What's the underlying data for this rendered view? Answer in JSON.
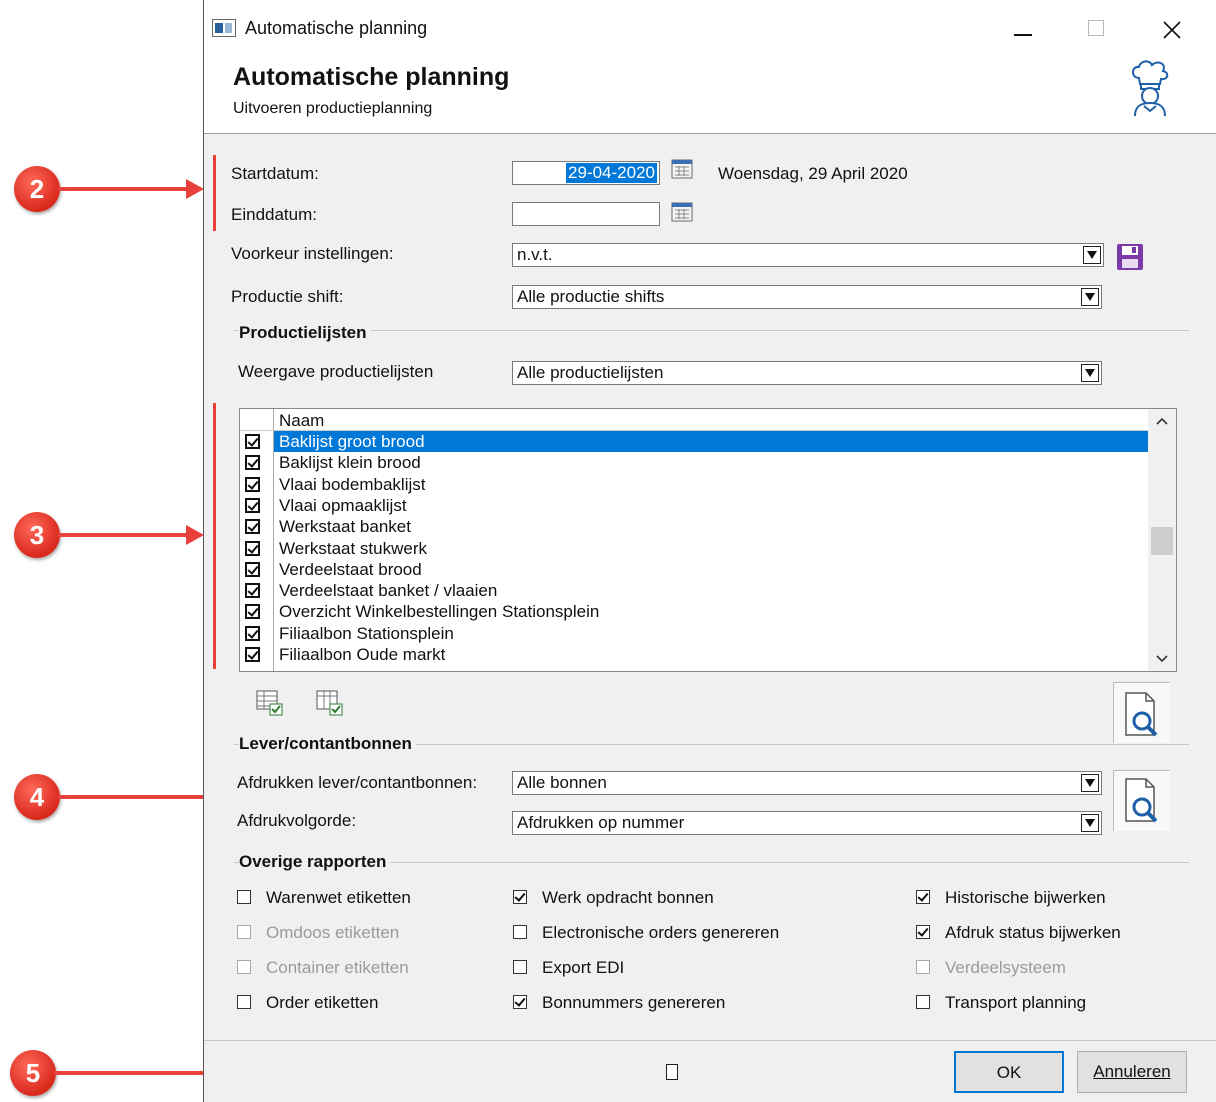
{
  "window": {
    "title": "Automatische planning",
    "heading": "Automatische planning",
    "subheading": "Uitvoeren productieplanning"
  },
  "form": {
    "startdatum_label": "Startdatum:",
    "startdatum_value": "29-04-2020",
    "startdatum_text": "Woensdag, 29 April 2020",
    "einddatum_label": "Einddatum:",
    "einddatum_value": "",
    "voorkeur_label": "Voorkeur instellingen:",
    "voorkeur_value": "n.v.t.",
    "shift_label": "Productie shift:",
    "shift_value": "Alle productie shifts"
  },
  "productielijsten": {
    "group_label": "Productielijsten",
    "weergave_label": "Weergave productielijsten",
    "weergave_value": "Alle productielijsten",
    "column_header": "Naam",
    "items": [
      {
        "name": "Baklijst groot brood",
        "checked": true,
        "selected": true
      },
      {
        "name": "Baklijst klein brood",
        "checked": true,
        "selected": false
      },
      {
        "name": "Vlaai bodembaklijst",
        "checked": true,
        "selected": false
      },
      {
        "name": "Vlaai opmaaklijst",
        "checked": true,
        "selected": false
      },
      {
        "name": "Werkstaat banket",
        "checked": true,
        "selected": false
      },
      {
        "name": "Werkstaat stukwerk",
        "checked": true,
        "selected": false
      },
      {
        "name": "Verdeelstaat brood",
        "checked": true,
        "selected": false
      },
      {
        "name": "Verdeelstaat banket / vlaaien",
        "checked": true,
        "selected": false
      },
      {
        "name": "Overzicht Winkelbestellingen Stationsplein",
        "checked": true,
        "selected": false
      },
      {
        "name": "Filiaalbon Stationsplein",
        "checked": true,
        "selected": false
      },
      {
        "name": "Filiaalbon Oude markt",
        "checked": true,
        "selected": false
      }
    ]
  },
  "lever": {
    "group_label": "Lever/contantbonnen",
    "afdrukken_label": "Afdrukken lever/contantbonnen:",
    "afdrukken_value": "Alle bonnen",
    "volgorde_label": "Afdrukvolgorde:",
    "volgorde_value": "Afdrukken op nummer"
  },
  "overige": {
    "group_label": "Overige rapporten",
    "col1": [
      {
        "label": "Warenwet etiketten",
        "checked": false,
        "disabled": false
      },
      {
        "label": "Omdoos etiketten",
        "checked": false,
        "disabled": true
      },
      {
        "label": "Container etiketten",
        "checked": false,
        "disabled": true
      },
      {
        "label": "Order etiketten",
        "checked": false,
        "disabled": false
      }
    ],
    "col2": [
      {
        "label": "Werk opdracht bonnen",
        "checked": true,
        "disabled": false
      },
      {
        "label": "Electronische orders genereren",
        "checked": false,
        "disabled": false
      },
      {
        "label": "Export EDI",
        "checked": false,
        "disabled": false
      },
      {
        "label": "Bonnummers genereren",
        "checked": true,
        "disabled": false
      }
    ],
    "col3": [
      {
        "label": "Historische bijwerken",
        "checked": true,
        "disabled": false
      },
      {
        "label": "Afdruk status bijwerken",
        "checked": true,
        "disabled": false
      },
      {
        "label": "Verdeelsysteem",
        "checked": false,
        "disabled": true
      },
      {
        "label": "Transport planning",
        "checked": false,
        "disabled": false
      }
    ]
  },
  "buttons": {
    "ok": "OK",
    "annuleren": "Annuleren"
  },
  "callouts": [
    "2",
    "3",
    "4",
    "5"
  ],
  "colors": {
    "selection": "#0078d7",
    "callout": "#e8403a",
    "save_icon": "#7b3aa8"
  }
}
